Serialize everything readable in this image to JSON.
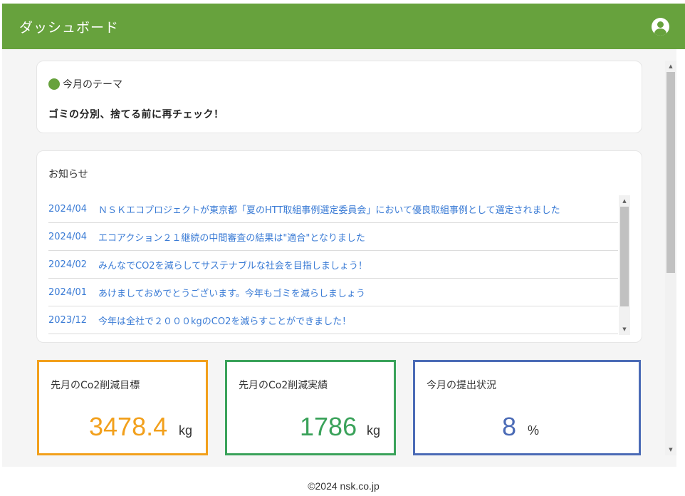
{
  "header": {
    "title": "ダッシュボード",
    "user_icon": "user-circle-icon"
  },
  "theme": {
    "heading": "今月のテーマ",
    "text": "ゴミの分別、捨てる前に再チェック！",
    "dot_color": "#67a23d"
  },
  "news": {
    "heading": "お知らせ",
    "items": [
      {
        "date": "2024/04",
        "title": "ＮＳＫエコプロジェクトが東京都「夏のHTT取組事例選定委員会」において優良取組事例として選定されました"
      },
      {
        "date": "2024/04",
        "title": "エコアクション２１継続の中間審査の結果は\"適合\"となりました"
      },
      {
        "date": "2024/02",
        "title": "みんなでCO2を減らしてサステナブルな社会を目指しましょう！"
      },
      {
        "date": "2024/01",
        "title": "あけましておめでとうございます。今年もゴミを減らしましょう"
      },
      {
        "date": "2023/12",
        "title": "今年は全社で２０００kgのCO2を減らすことができました！"
      }
    ]
  },
  "stats": [
    {
      "label": "先月のCo2削減目標",
      "value": "3478.4",
      "unit": "kg",
      "color": "#f2a01c"
    },
    {
      "label": "先月のCo2削減実績",
      "value": "1786",
      "unit": "kg",
      "color": "#3aa25a"
    },
    {
      "label": "今月の提出状況",
      "value": "8",
      "unit": "%",
      "color": "#4b6bb6"
    }
  ],
  "footer": {
    "copyright": "©2024 nsk.co.jp"
  },
  "colors": {
    "brand": "#67a23d",
    "link": "#3a7bd5"
  }
}
